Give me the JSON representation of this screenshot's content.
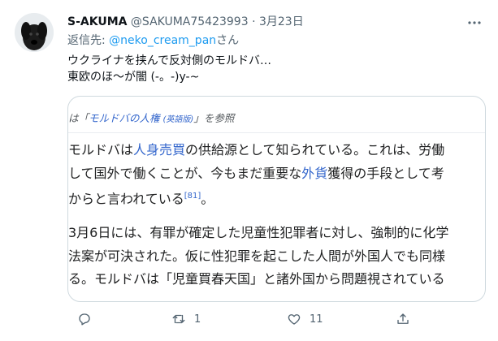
{
  "tweet": {
    "display_name": "S-AKUMA",
    "handle": "@SAKUMA75423993",
    "separator": "·",
    "date": "3月23日",
    "reply_prefix": "返信先: ",
    "reply_handle": "@neko_cream_pan",
    "reply_suffix": "さん",
    "text_line1": "ウクライナを挟んで反対側のモルドバ…",
    "text_line2": "東欧のほ～が闇 (-。-)y-~"
  },
  "media": {
    "see_also": {
      "prefix": "は「",
      "link": "モルドバの人権",
      "lang": "(英語版)",
      "suffix": "」を参照"
    },
    "para1": {
      "l1_a": "モルドバは",
      "l1_link": "人身売買",
      "l1_b": "の供給源として知られている。これは、労働",
      "l2_a": "して国外で働くことが、今もまだ重要な",
      "l2_link": "外貨",
      "l2_b": "獲得の手段として考",
      "l3_a": "からと言われている",
      "l3_ref": "[81]",
      "l3_b": "。"
    },
    "para2": {
      "l1": "3月6日には、有罪が確定した児童性犯罪者に対し、強制的に化学",
      "l2": "法案が可決された。仮に性犯罪を起こした人間が外国人でも同様",
      "l3": "る。モルドバは「児童買春天国」と諸外国から問題視されている"
    }
  },
  "actions": {
    "reply_count": "",
    "retweet_count": "1",
    "like_count": "11"
  },
  "colors": {
    "link_blue": "#1d9bf0",
    "wiki_link": "#3366cc",
    "muted": "#536471"
  },
  "icons": [
    "more-icon",
    "reply-icon",
    "retweet-icon",
    "like-icon",
    "share-icon"
  ]
}
